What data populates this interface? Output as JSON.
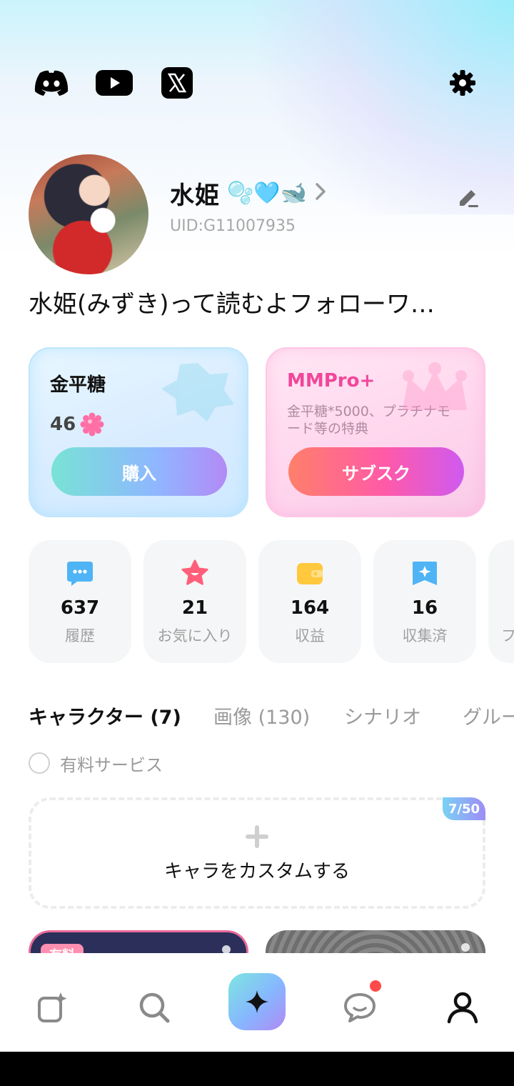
{
  "social": {
    "discord_icon": "discord-icon",
    "youtube_icon": "youtube-icon",
    "x_icon": "x-icon",
    "settings_icon": "gear-icon"
  },
  "profile": {
    "name": "水姫",
    "name_emojis": "🫧🩵🐋",
    "uid": "UID:G11007935",
    "bio": "水姫(みずき)って読むよフォローワ…"
  },
  "promo": {
    "sugar": {
      "title": "金平糖",
      "count": "46",
      "button": "購入"
    },
    "pro": {
      "title": "MMPro+",
      "description": "金平糖*5000、プラチナモード等の特典",
      "button": "サブスク"
    }
  },
  "stats": [
    {
      "value": "637",
      "label": "履歴",
      "icon": "chat-bubble-icon",
      "color": "#4fb4f5"
    },
    {
      "value": "21",
      "label": "お気に入り",
      "icon": "star-face-icon",
      "color": "#ff5f7a"
    },
    {
      "value": "164",
      "label": "収益",
      "icon": "wallet-icon",
      "color": "#ffc83d"
    },
    {
      "value": "16",
      "label": "収集済",
      "icon": "bookmark-icon",
      "color": "#4fb4f5"
    },
    {
      "value": "",
      "label": "フ",
      "icon": "",
      "color": "#cccccc"
    }
  ],
  "tabs": [
    {
      "label": "キャラクター (7)",
      "active": true
    },
    {
      "label": "画像 (130)",
      "active": false
    },
    {
      "label": "シナリオ",
      "active": false
    },
    {
      "label": "グルー",
      "active": false
    }
  ],
  "filter": {
    "label": "有料サービス"
  },
  "create": {
    "label": "キャラをカスタムする",
    "quota": "7/50"
  },
  "cards": {
    "paid_badge": "有料"
  },
  "nav": {
    "items": [
      "create-icon",
      "search-icon",
      "sparkle-icon",
      "message-icon",
      "profile-icon"
    ]
  },
  "colors": {
    "accent_pink": "#f0479a",
    "notification": "#ff4a4a"
  }
}
